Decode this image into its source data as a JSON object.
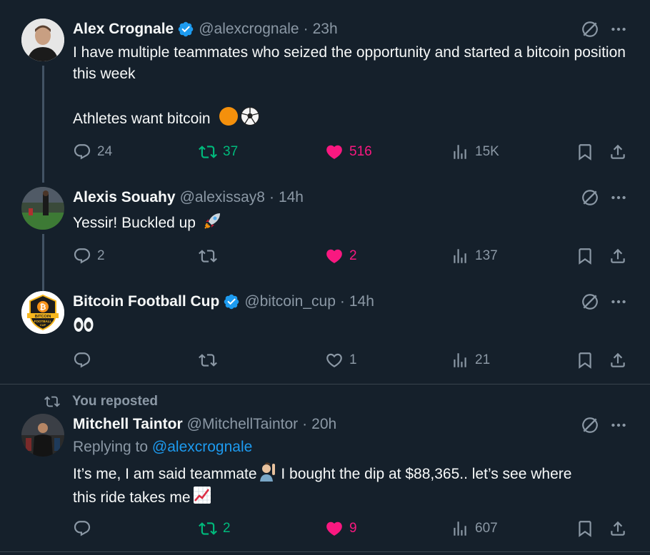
{
  "tweets": [
    {
      "name": "Alex Crognale",
      "verified": true,
      "handle": "@alexcrognale",
      "time": "23h",
      "lines": [
        "I have multiple teammates who seized the opportunity and started a bitcoin position this week",
        "",
        "Athletes want bitcoin"
      ],
      "emojis": [
        "orange-circle",
        "soccer-ball"
      ],
      "replies": "24",
      "reposts": "37",
      "reposted": true,
      "likes": "516",
      "liked": true,
      "views": "15K"
    },
    {
      "name": "Alexis Souahy",
      "verified": false,
      "handle": "@alexissay8",
      "time": "14h",
      "text": "Yessir! Buckled up",
      "emojis": [
        "rocket"
      ],
      "replies": "2",
      "reposts": "",
      "likes": "2",
      "liked": true,
      "views": "137"
    },
    {
      "name": "Bitcoin Football Cup",
      "verified": true,
      "handle": "@bitcoin_cup",
      "time": "14h",
      "text": "",
      "emojis": [
        "eyes"
      ],
      "replies": "",
      "reposts": "",
      "likes": "1",
      "liked": false,
      "views": "21",
      "avatar_text": "BITCOIN FOOTBALL CUP"
    },
    {
      "repost_label": "You reposted",
      "name": "Mitchell Taintor",
      "verified": false,
      "handle": "@MitchellTaintor",
      "time": "20h",
      "reply_prefix": "Replying to",
      "reply_to": "@alexcrognale",
      "line1a": "It’s me, I am said teammate",
      "line1b": " I bought the dip at $88,365.. let’s see where",
      "line2": "this ride takes me",
      "emojis": [
        "person-raising-hand",
        "chart-increasing"
      ],
      "replies": "",
      "reposts": "2",
      "reposted": true,
      "likes": "9",
      "liked": true,
      "views": "607"
    }
  ],
  "colors": {
    "background": "#15202b",
    "text": "#f7f9f9",
    "secondary": "#8b98a5",
    "link": "#1d9bf0",
    "like": "#f91880",
    "repost": "#00ba7c",
    "divider": "#38444d"
  }
}
